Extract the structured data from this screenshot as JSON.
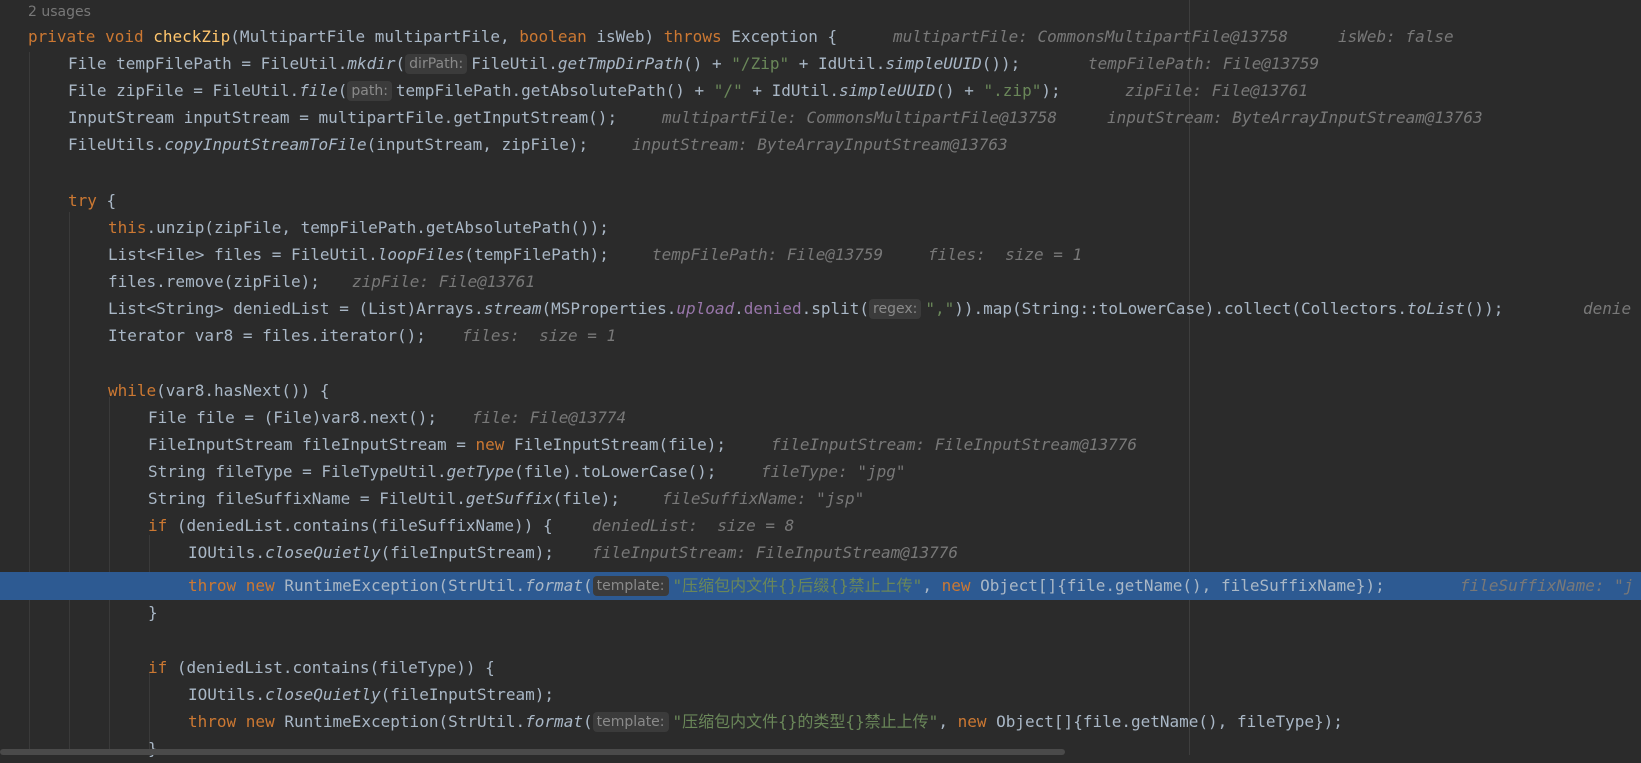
{
  "header": {
    "usages": "2 usages"
  },
  "code": {
    "sig_kw": "private void ",
    "sig_fn": "checkZip",
    "sig_a": "(MultipartFile multipartFile, ",
    "sig_bool": "boolean ",
    "sig_b": "isWeb) ",
    "sig_throws": "throws ",
    "sig_c": "Exception {",
    "sig_hint1": "multipartFile: CommonsMultipartFile@13758",
    "sig_hint2": "isWeb: false",
    "l1_a": "File tempFilePath = FileUtil.",
    "l1_m": "mkdir",
    "l1_b": "(",
    "l1_p": "dirPath:",
    "l1_c": "FileUtil.",
    "l1_m2": "getTmpDirPath",
    "l1_d": "() + ",
    "l1_s": "\"/Zip\"",
    "l1_e": " + IdUtil.",
    "l1_m3": "simpleUUID",
    "l1_f": "());",
    "l1_h": "tempFilePath: File@13759",
    "l2_a": "File zipFile = FileUtil.",
    "l2_m": "file",
    "l2_b": "(",
    "l2_p": "path:",
    "l2_c": "tempFilePath.getAbsolutePath() + ",
    "l2_s1": "\"/\"",
    "l2_d": " + IdUtil.",
    "l2_m2": "simpleUUID",
    "l2_e": "() + ",
    "l2_s2": "\".zip\"",
    "l2_f": ");",
    "l2_h": "zipFile: File@13761",
    "l3_a": "InputStream inputStream = multipartFile.getInputStream();",
    "l3_h1": "multipartFile: CommonsMultipartFile@13758",
    "l3_h2": "inputStream: ByteArrayInputStream@13763",
    "l4_a": "FileUtils.",
    "l4_m": "copyInputStreamToFile",
    "l4_b": "(inputStream, zipFile);",
    "l4_h": "inputStream: ByteArrayInputStream@13763",
    "l6_kw": "try",
    "l6_b": " {",
    "l7_kw": "this",
    "l7_b": ".unzip(zipFile, tempFilePath.getAbsolutePath());",
    "l8_a": "List<File> files = FileUtil.",
    "l8_m": "loopFiles",
    "l8_b": "(tempFilePath);",
    "l8_h1": "tempFilePath: File@13759",
    "l8_h2": "files:  size = 1",
    "l9_a": "files.remove(zipFile);",
    "l9_h": "zipFile: File@13761",
    "l10_a": "List<String> deniedList = (List)Arrays.",
    "l10_m": "stream",
    "l10_b": "(MSProperties.",
    "l10_f1": "upload",
    "l10_c": ".",
    "l10_f2": "denied",
    "l10_d": ".split(",
    "l10_p": "regex:",
    "l10_s": "\",\"",
    "l10_e": ")).map(String::toLowerCase).collect(Collectors.",
    "l10_m2": "toList",
    "l10_f": "());",
    "l10_h": "denie",
    "l11_a": "Iterator var8 = files.iterator();",
    "l11_h": "files:  size = 1",
    "l13_kw": "while",
    "l13_b": "(var8.hasNext()) {",
    "l14_a": "File file = (File)var8.next();",
    "l14_h": "file: File@13774",
    "l15_a": "FileInputStream fileInputStream = ",
    "l15_kw": "new ",
    "l15_b": "FileInputStream(file);",
    "l15_h": "fileInputStream: FileInputStream@13776",
    "l16_a": "String fileType = FileTypeUtil.",
    "l16_m": "getType",
    "l16_b": "(file).toLowerCase();",
    "l16_h": "fileType: \"jpg\"",
    "l17_a": "String fileSuffixName = FileUtil.",
    "l17_m": "getSuffix",
    "l17_b": "(file);",
    "l17_h": "fileSuffixName: \"jsp\"",
    "l18_kw": "if ",
    "l18_b": "(deniedList.contains(fileSuffixName)) {",
    "l18_h": "deniedList:  size = 8",
    "l19_a": "IOUtils.",
    "l19_m": "closeQuietly",
    "l19_b": "(fileInputStream);",
    "l19_h": "fileInputStream: FileInputStream@13776",
    "l20_kw1": "throw new ",
    "l20_a": "RuntimeException(StrUtil.",
    "l20_m": "format",
    "l20_b": "(",
    "l20_p": "template:",
    "l20_s": "\"压缩包内文件{}后缀{}禁止上传\"",
    "l20_c": ", ",
    "l20_kw2": "new ",
    "l20_d": "Object[]{file.getName(), fileSuffixName});",
    "l20_h": "fileSuffixName: \"j",
    "l21_a": "}",
    "l23_kw": "if ",
    "l23_b": "(deniedList.contains(fileType)) {",
    "l24_a": "IOUtils.",
    "l24_m": "closeQuietly",
    "l24_b": "(fileInputStream);",
    "l25_kw1": "throw new ",
    "l25_a": "RuntimeException(StrUtil.",
    "l25_m": "format",
    "l25_b": "(",
    "l25_p": "template:",
    "l25_s": "\"压缩包内文件{}的类型{}禁止上传\"",
    "l25_c": ", ",
    "l25_kw2": "new ",
    "l25_d": "Object[]{file.getName(), fileType});",
    "l26_a": "}"
  }
}
